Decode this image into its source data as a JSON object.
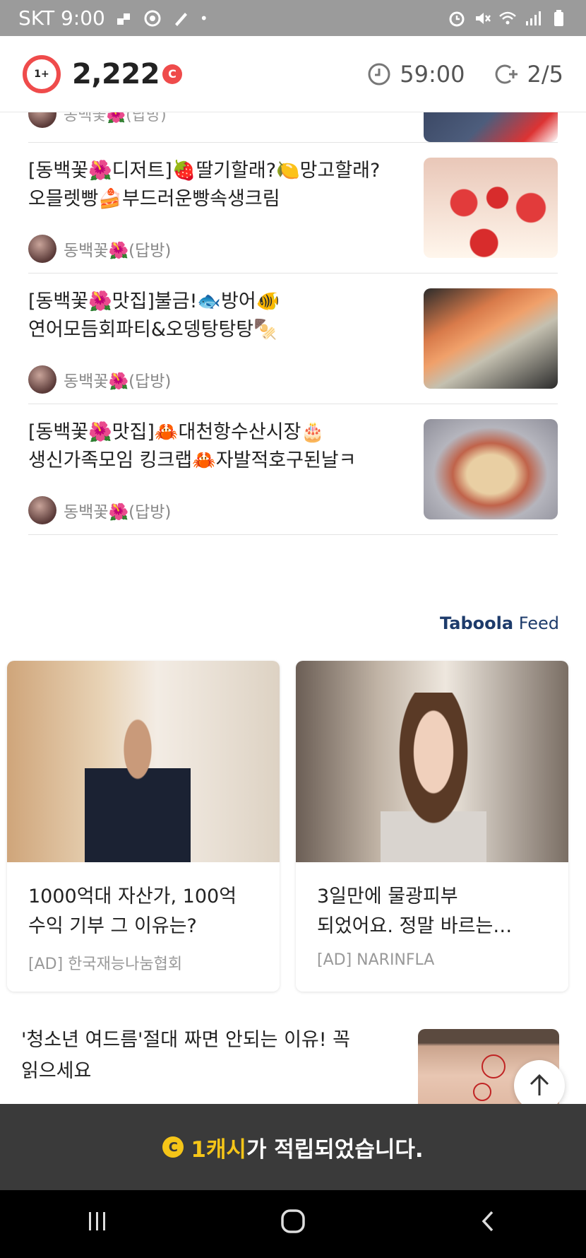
{
  "status_bar": {
    "carrier_time": "SKT 9:00",
    "dot": "•"
  },
  "header": {
    "level_badge": "1+",
    "points": "2,222",
    "points_unit": "C",
    "timer": "59:00",
    "count": "2/5"
  },
  "partial_row": {
    "author": "동백꽃🌺(답방)"
  },
  "articles": [
    {
      "title_line1": "[동백꽃🌺디저트]🍓딸기할래?🍋망고할래?",
      "title_line2": "오믈렛빵🍰부드러운빵속생크림",
      "author": "동백꽃🌺(답방)"
    },
    {
      "title_line1": "[동백꽃🌺맛집]불금!🐟방어🐠",
      "title_line2": "연어모듬회파티&오뎅탕탕탕🍢",
      "author": "동백꽃🌺(답방)"
    },
    {
      "title_line1": "[동백꽃🌺맛집]🦀대천항수산시장🎂",
      "title_line2": "생신가족모임 킹크랩🦀자발적호구된날ㅋ",
      "author": "동백꽃🌺(답방)"
    }
  ],
  "feed": {
    "brand": "Taboola",
    "label": "Feed"
  },
  "ad_cards": [
    {
      "title_line1": "1000억대 자산가, 100억",
      "title_line2": "수익 기부 그 이유는?",
      "source": "[AD] 한국재능나눔협회"
    },
    {
      "title_line1": "3일만에 물광피부",
      "title_line2": "되었어요. 정말 바르는…",
      "source": "[AD] NARINFLA"
    }
  ],
  "bottom_article": {
    "title_line1": "'청소년 여드름'절대 짜면 안되는 이유! 꼭",
    "title_line2": "읽으세요"
  },
  "toast": {
    "coin": "C",
    "highlight": "1캐시",
    "rest": "가 적립되었습니다."
  },
  "nav": {
    "recents": "|||",
    "home": "◯",
    "back": "‹"
  },
  "colors": {
    "accent_red": "#ef4b4b",
    "toast_yellow": "#f5c518",
    "taboola_blue": "#1d3b6b"
  },
  "icons": [
    "alarm-icon",
    "mute-icon",
    "wifi-icon",
    "signal-icon",
    "battery-icon",
    "clock-icon",
    "coin-plus-icon",
    "arrow-up-icon"
  ]
}
